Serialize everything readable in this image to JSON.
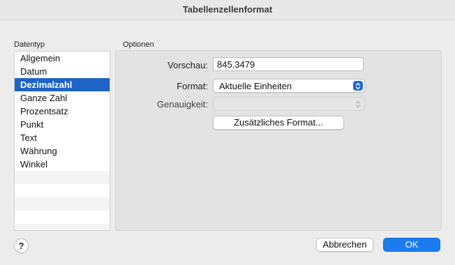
{
  "window": {
    "title": "Tabellenzellenformat"
  },
  "datatype": {
    "label": "Datentyp",
    "items": [
      "Allgemein",
      "Datum",
      "Dezimalzahl",
      "Ganze Zahl",
      "Prozentsatz",
      "Punkt",
      "Text",
      "Währung",
      "Winkel"
    ],
    "selected": "Dezimalzahl"
  },
  "options": {
    "label": "Optionen",
    "preview_label": "Vorschau:",
    "preview_value": "845.3479",
    "format_label": "Format:",
    "format_value": "Aktuelle Einheiten",
    "precision_label": "Genauigkeit:",
    "precision_value": "",
    "extra_format_button": "Zusätzliches Format..."
  },
  "footer": {
    "help_label": "?",
    "cancel_label": "Abbrechen",
    "ok_label": "OK"
  },
  "colors": {
    "selection": "#1e63c6",
    "primary_button": "#1b7cf0"
  }
}
